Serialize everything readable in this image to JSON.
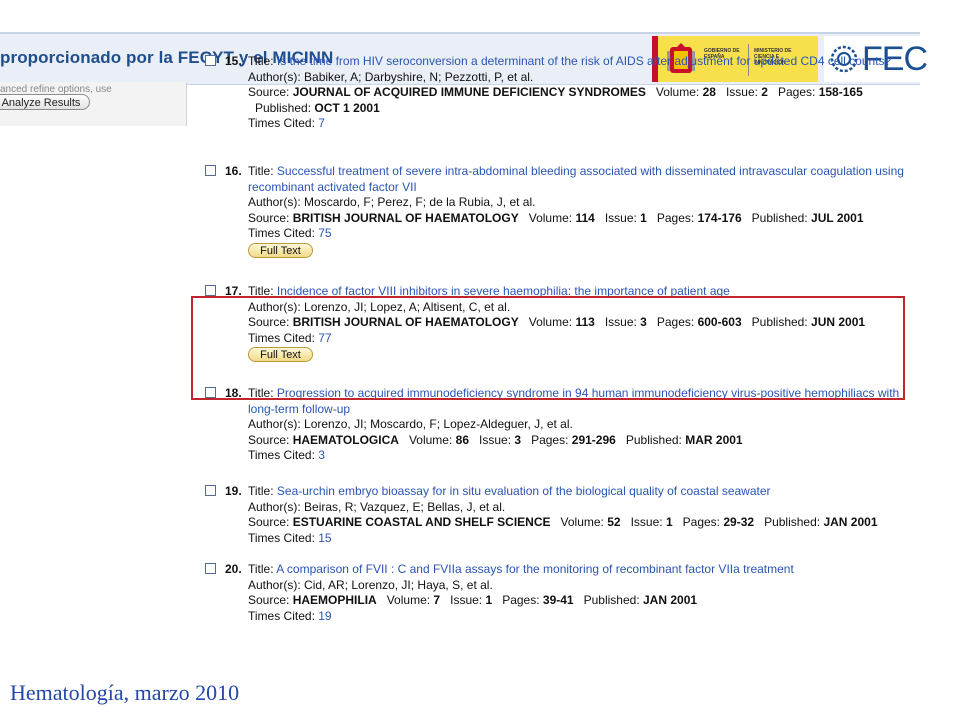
{
  "header": {
    "banner_text": "proporcionado por la FECYT y el MICINN",
    "gov_logo_text_1": "GOBIERNO DE ESPAÑA",
    "gov_logo_text_2": "MINISTERIO DE CIENCIA E INNOVACIÓN",
    "fec_logo_text": "FEC"
  },
  "sidebar": {
    "partial_text": "anced refine options, use",
    "analyze_button": "Analyze Results"
  },
  "labels": {
    "title": "Title:",
    "authors": "Author(s):",
    "source": "Source:",
    "volume": "Volume:",
    "issue": "Issue:",
    "pages": "Pages:",
    "published": "Published:",
    "times_cited": "Times Cited:",
    "full_text": "Full Text"
  },
  "records": [
    {
      "number": "15.",
      "title": "Is the time from HIV seroconversion a determinant of the risk of AIDS after adjustment for updated CD4 cell counts?",
      "authors": "Babiker, A; Darbyshire, N; Pezzotti, P, et al.",
      "journal": "JOURNAL OF ACQUIRED IMMUNE DEFICIENCY SYNDROMES",
      "volume": "28",
      "issue": "2",
      "pages": "158-165",
      "published": "OCT 1 2001",
      "times_cited": "7",
      "full_text": false
    },
    {
      "number": "16.",
      "title": "Successful treatment of severe intra-abdominal bleeding associated with disseminated intravascular coagulation using recombinant activated factor VII",
      "authors": "Moscardo, F; Perez, F; de la Rubia, J, et al.",
      "journal": "BRITISH JOURNAL OF HAEMATOLOGY",
      "volume": "114",
      "issue": "1",
      "pages": "174-176",
      "published": "JUL 2001",
      "times_cited": "75",
      "full_text": true
    },
    {
      "number": "17.",
      "title": "Incidence of factor VIII inhibitors in severe haemophilia: the importance of patient age",
      "authors": "Lorenzo, JI; Lopez, A; Altisent, C, et al.",
      "journal": "BRITISH JOURNAL OF HAEMATOLOGY",
      "volume": "113",
      "issue": "3",
      "pages": "600-603",
      "published": "JUN 2001",
      "times_cited": "77",
      "full_text": true
    },
    {
      "number": "18.",
      "title": "Progression to acquired immunodeficiency syndrome in 94 human immunodeficiency virus-positive hemophiliacs with long-term follow-up",
      "authors": "Lorenzo, JI; Moscardo, F; Lopez-Aldeguer, J, et al.",
      "journal": "HAEMATOLOGICA",
      "volume": "86",
      "issue": "3",
      "pages": "291-296",
      "published": "MAR 2001",
      "times_cited": "3",
      "full_text": false
    },
    {
      "number": "19.",
      "title": "Sea-urchin embryo bioassay for in situ evaluation of the biological quality of coastal seawater",
      "authors": "Beiras, R; Vazquez, E; Bellas, J, et al.",
      "journal": "ESTUARINE COASTAL AND SHELF SCIENCE",
      "volume": "52",
      "issue": "1",
      "pages": "29-32",
      "published": "JAN 2001",
      "times_cited": "15",
      "full_text": false
    },
    {
      "number": "20.",
      "title": "A comparison of FVII : C and FVIIa assays for the monitoring of recombinant factor VIIa treatment",
      "authors": "Cid, AR; Lorenzo, JI; Haya, S, et al.",
      "journal": "HAEMOPHILIA",
      "volume": "7",
      "issue": "1",
      "pages": "39-41",
      "published": "JAN 2001",
      "times_cited": "19",
      "full_text": false
    }
  ],
  "footer": {
    "caption": "Hematología, marzo 2010"
  },
  "colors": {
    "link": "#2a55b3",
    "highlight_border": "#c0262c",
    "banner": "#1f4e8c",
    "footer": "#2448a8"
  }
}
